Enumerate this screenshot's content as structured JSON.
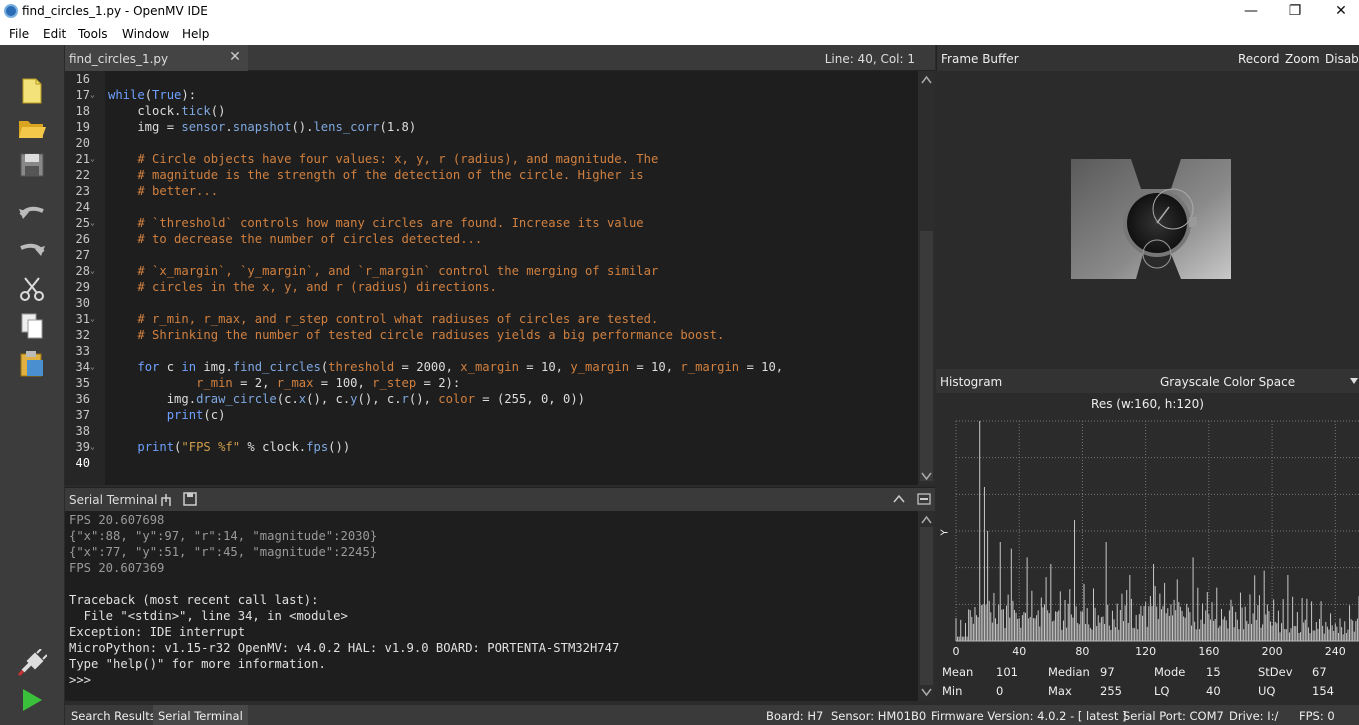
{
  "window": {
    "title": "find_circles_1.py - OpenMV IDE",
    "minimize": "—",
    "restore": "❐",
    "close": "✕"
  },
  "menu": [
    {
      "label": "File"
    },
    {
      "label": "Edit"
    },
    {
      "label": "Tools"
    },
    {
      "label": "Window"
    },
    {
      "label": "Help"
    }
  ],
  "toolbar": [
    "new-file",
    "open-file",
    "save-file",
    "undo",
    "redo",
    "cut",
    "copy",
    "paste",
    "connect",
    "run"
  ],
  "editor": {
    "tab_label": "find_circles_1.py",
    "position": "Line: 40, Col: 1",
    "lines": [
      {
        "n": "16",
        "html": ""
      },
      {
        "n": "17",
        "fold": true,
        "html": "<span class='k'>while</span>(<span class='k'>True</span>):"
      },
      {
        "n": "18",
        "html": "    clock.<span class='fn'>tick</span>()"
      },
      {
        "n": "19",
        "html": "    img = <span class='fn'>sensor</span>.<span class='fn'>snapshot</span>().<span class='fn'>lens_corr</span>(1.8)"
      },
      {
        "n": "20",
        "html": ""
      },
      {
        "n": "21",
        "fold": true,
        "html": "    <span class='cm'># Circle objects have four values: x, y, r (radius), and magnitude. The</span>"
      },
      {
        "n": "22",
        "html": "    <span class='cm'># magnitude is the strength of the detection of the circle. Higher is</span>"
      },
      {
        "n": "23",
        "html": "    <span class='cm'># better...</span>"
      },
      {
        "n": "24",
        "html": ""
      },
      {
        "n": "25",
        "fold": true,
        "html": "    <span class='cm'># `threshold` controls how many circles are found. Increase its value</span>"
      },
      {
        "n": "26",
        "html": "    <span class='cm'># to decrease the number of circles detected...</span>"
      },
      {
        "n": "27",
        "html": ""
      },
      {
        "n": "28",
        "fold": true,
        "html": "    <span class='cm'># `x_margin`, `y_margin`, and `r_margin` control the merging of similar</span>"
      },
      {
        "n": "29",
        "html": "    <span class='cm'># circles in the x, y, and r (radius) directions.</span>"
      },
      {
        "n": "30",
        "html": ""
      },
      {
        "n": "31",
        "fold": true,
        "html": "    <span class='cm'># r_min, r_max, and r_step control what radiuses of circles are tested.</span>"
      },
      {
        "n": "32",
        "html": "    <span class='cm'># Shrinking the number of tested circle radiuses yields a big performance boost.</span>"
      },
      {
        "n": "33",
        "html": ""
      },
      {
        "n": "34",
        "fold": true,
        "html": "    <span class='k'>for</span> c <span class='k'>in</span> img.<span class='fn'>find_circles</span>(<span class='kw'>threshold</span> = 2000, <span class='kw'>x_margin</span> = 10, <span class='kw'>y_margin</span> = 10, <span class='kw'>r_margin</span> = 10,"
      },
      {
        "n": "35",
        "html": "            <span class='kw'>r_min</span> = 2, <span class='kw'>r_max</span> = 100, <span class='kw'>r_step</span> = 2):"
      },
      {
        "n": "36",
        "html": "        img.<span class='fn'>draw_circle</span>(c.<span class='fn'>x</span>(), c.<span class='fn'>y</span>(), c.<span class='fn'>r</span>(), <span class='kw'>color</span> = (255, 0, 0))"
      },
      {
        "n": "37",
        "html": "        <span class='k'>print</span>(c)"
      },
      {
        "n": "38",
        "html": ""
      },
      {
        "n": "39",
        "fold": true,
        "html": "    <span class='k'>print</span>(<span class='s'>\"FPS %f\"</span> % clock.<span class='fn'>fps</span>())"
      },
      {
        "n": "40",
        "html": ""
      }
    ]
  },
  "terminal": {
    "title": "Serial Terminal",
    "lines": [
      {
        "t": "FPS 20.607698",
        "dim": true
      },
      {
        "t": "{\"x\":88, \"y\":97, \"r\":14, \"magnitude\":2030}",
        "dim": true
      },
      {
        "t": "{\"x\":77, \"y\":51, \"r\":45, \"magnitude\":2245}",
        "dim": true
      },
      {
        "t": "FPS 20.607369",
        "dim": true
      },
      {
        "t": ""
      },
      {
        "t": "Traceback (most recent call last):"
      },
      {
        "t": "  File \"<stdin>\", line 34, in <module>"
      },
      {
        "t": "Exception: IDE interrupt"
      },
      {
        "t": "MicroPython: v1.15-r32 OpenMV: v4.0.2 HAL: v1.9.0 BOARD: PORTENTA-STM32H747"
      },
      {
        "t": "Type \"help()\" for more information."
      },
      {
        "t": ">>>"
      }
    ]
  },
  "bottom_tabs": {
    "search": "Search Results",
    "serial": "Serial Terminal"
  },
  "status": {
    "board": "Board: H7",
    "sensor": "Sensor: HM01B0",
    "firmware": "Firmware Version: 4.0.2 - [ latest ]",
    "port": "Serial Port: COM7",
    "drive": "Drive: I:/",
    "fps": "FPS: 0"
  },
  "framebuffer": {
    "title": "Frame Buffer",
    "record": "Record",
    "zoom": "Zoom",
    "disable": "Disable"
  },
  "histogram": {
    "title": "Histogram",
    "colorspace": "Grayscale Color Space",
    "resolution": "Res (w:160, h:120)",
    "ylabel": "Y"
  },
  "stats": {
    "mean_label": "Mean",
    "mean": "101",
    "median_label": "Median",
    "median": "97",
    "mode_label": "Mode",
    "mode": "15",
    "stdev_label": "StDev",
    "stdev": "67",
    "min_label": "Min",
    "min": "0",
    "max_label": "Max",
    "max": "255",
    "lq_label": "LQ",
    "lq": "40",
    "uq_label": "UQ",
    "uq": "154"
  },
  "chart_data": {
    "type": "bar",
    "x_ticks": [
      "0",
      "40",
      "80",
      "120",
      "160",
      "200",
      "240"
    ],
    "xlim": [
      0,
      255
    ],
    "ylabel": "Y",
    "grid": true,
    "peaks": [
      [
        15,
        1.0
      ],
      [
        18,
        0.7
      ],
      [
        20,
        0.5
      ],
      [
        28,
        0.45
      ],
      [
        35,
        0.42
      ],
      [
        45,
        0.38
      ],
      [
        60,
        0.35
      ],
      [
        75,
        0.55
      ],
      [
        95,
        0.45
      ],
      [
        110,
        0.3
      ],
      [
        125,
        0.35
      ],
      [
        140,
        0.28
      ],
      [
        150,
        0.38
      ],
      [
        180,
        0.22
      ],
      [
        195,
        0.32
      ],
      [
        210,
        0.3
      ],
      [
        225,
        0.18
      ],
      [
        240,
        0.08
      ]
    ]
  }
}
